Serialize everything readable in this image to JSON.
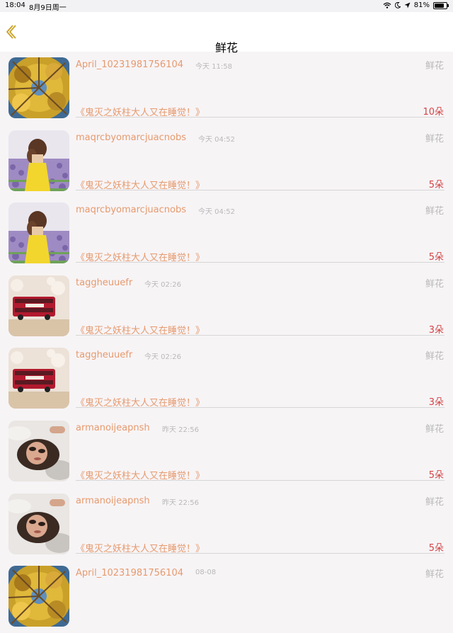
{
  "status_bar": {
    "time": "18:04",
    "date": "8月9日周一",
    "battery_percent": "81%",
    "battery_level": 0.81,
    "icons": [
      "wifi-icon",
      "moon-icon",
      "location-icon",
      "battery-icon"
    ]
  },
  "nav": {
    "title": "鲜花",
    "back_icon": "chevron-left-icon",
    "accent_color": "#c9a227"
  },
  "colors": {
    "name": "#e69a6e",
    "count": "#d14545",
    "muted": "#b9b9b9"
  },
  "rows": [
    {
      "username": "April_10231981756104",
      "time": "今天 11:58",
      "type": "鲜花",
      "title": "《鬼灭之妖柱大人又在睡觉！》",
      "count": "10朵",
      "avatar": "autumn-trees"
    },
    {
      "username": "maqrcbyomarcjuacnobs",
      "time": "今天 04:52",
      "type": "鲜花",
      "title": "《鬼灭之妖柱大人又在睡觉！》",
      "count": "5朵",
      "avatar": "girl-lavender"
    },
    {
      "username": "maqrcbyomarcjuacnobs",
      "time": "今天 04:52",
      "type": "鲜花",
      "title": "《鬼灭之妖柱大人又在睡觉！》",
      "count": "5朵",
      "avatar": "girl-lavender"
    },
    {
      "username": "taggheuuefr",
      "time": "今天 02:26",
      "type": "鲜花",
      "title": "《鬼灭之妖柱大人又在睡觉！》",
      "count": "3朵",
      "avatar": "london-bus"
    },
    {
      "username": "taggheuuefr",
      "time": "今天 02:26",
      "type": "鲜花",
      "title": "《鬼灭之妖柱大人又在睡觉！》",
      "count": "3朵",
      "avatar": "london-bus"
    },
    {
      "username": "armanoijeapnsh",
      "time": "昨天 22:56",
      "type": "鲜花",
      "title": "《鬼灭之妖柱大人又在睡觉！》",
      "count": "5朵",
      "avatar": "girl-lying"
    },
    {
      "username": "armanoijeapnsh",
      "time": "昨天 22:56",
      "type": "鲜花",
      "title": "《鬼灭之妖柱大人又在睡觉！》",
      "count": "5朵",
      "avatar": "girl-lying"
    },
    {
      "username": "April_10231981756104",
      "time": "08-08",
      "type": "鲜花",
      "title": "",
      "count": "",
      "avatar": "autumn-trees"
    }
  ]
}
